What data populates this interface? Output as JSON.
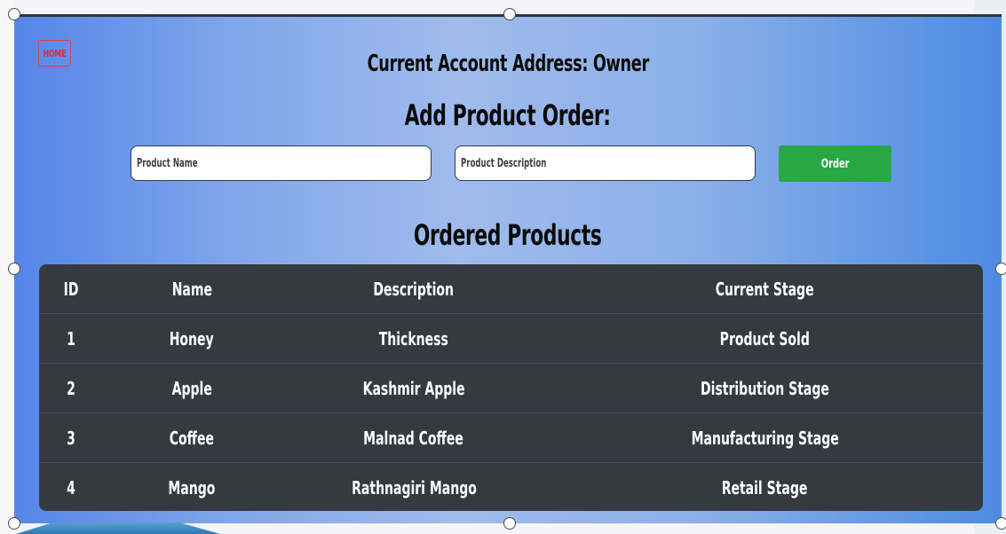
{
  "home_button": "HOME",
  "account_heading": "Current Account Address: Owner",
  "add_heading": "Add Product Order:",
  "inputs": {
    "product_name_placeholder": "Product Name",
    "product_description_placeholder": "Product Description"
  },
  "order_button": "Order",
  "ordered_heading": "Ordered Products",
  "table": {
    "columns": [
      "ID",
      "Name",
      "Description",
      "Current Stage"
    ],
    "rows": [
      [
        "1",
        "Honey",
        "Thickness",
        "Product Sold"
      ],
      [
        "2",
        "Apple",
        "Kashmir Apple",
        "Distribution Stage"
      ],
      [
        "3",
        "Coffee",
        "Malnad Coffee",
        "Manufacturing Stage"
      ],
      [
        "4",
        "Mango",
        "Rathnagiri Mango",
        "Retail Stage"
      ]
    ]
  },
  "colors": {
    "order_button": "#28a745",
    "home_button": "#e0273a",
    "table_background": "#343a40"
  }
}
